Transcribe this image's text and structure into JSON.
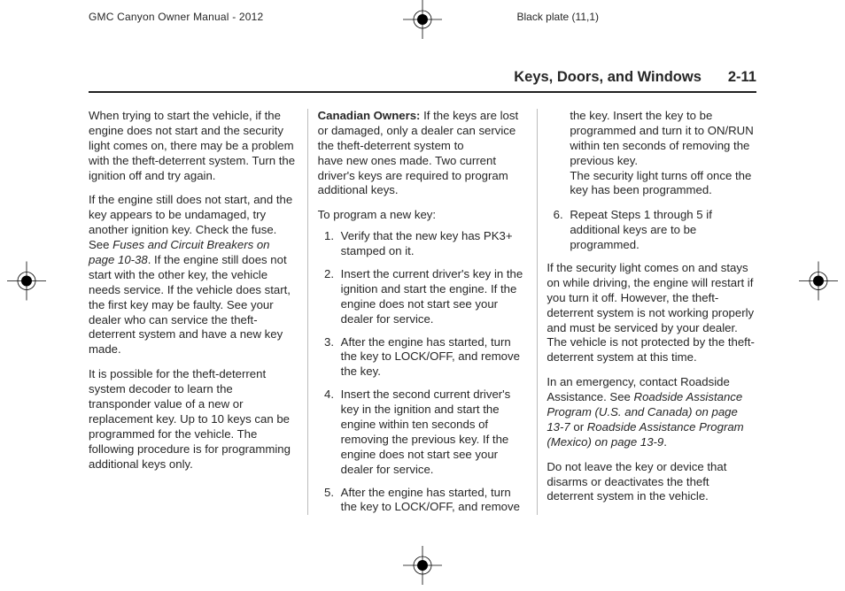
{
  "header": {
    "publication": "GMC Canyon Owner Manual - 2012",
    "plate": "Black plate (11,1)"
  },
  "running_head": {
    "section_title": "Keys, Doors, and Windows",
    "page_number": "2-11"
  },
  "body": {
    "p1": "When trying to start the vehicle, if the engine does not start and the security light comes on, there may be a problem with the theft-deterrent system. Turn the ignition off and try again.",
    "p2a": "If the engine still does not start, and the key appears to be undamaged, try another ignition key. Check the fuse. See ",
    "p2_italic": "Fuses and Circuit Breakers on page 10-38",
    "p2b": ". If the engine still does not start with the other key, the vehicle needs service. If the vehicle does start, the first key may be faulty. See your dealer who can service the theft-deterrent system and have a new key made.",
    "p3": "It is possible for the theft-deterrent system decoder to learn the transponder value of a new or replacement key. Up to 10 keys can be programmed for the vehicle. The following procedure is for programming additional keys only.",
    "p4_label": "Canadian Owners:",
    "p4_rest": "   If the keys are lost or damaged, only a dealer can service the theft-deterrent system to",
    "p5": "have new ones made. Two current driver's keys are required to program additional keys.",
    "p6": "To program a new key:",
    "steps": [
      "Verify that the new key has PK3+ stamped on it.",
      "Insert the current driver's key in the ignition and start the engine. If the engine does not start see your dealer for service.",
      "After the engine has started, turn the key to LOCK/OFF, and remove the key.",
      "Insert the second current driver's key in the ignition and start the engine within ten seconds of removing the previous key. If the engine does not start see your dealer for service.",
      "After the engine has started, turn the key to LOCK/OFF, and remove the key. Insert the key to be programmed and turn it to ON/RUN within ten seconds of removing the previous key."
    ],
    "step5_trail": "The security light turns off once the key has been programmed.",
    "step6": "Repeat Steps 1 through 5 if additional keys are to be programmed.",
    "p7": "If the security light comes on and stays on while driving, the engine will restart if you turn it off. However, the theft-deterrent system is not working properly and must be serviced by your dealer. The vehicle is not protected by the theft-deterrent system at this time.",
    "p8a": "In an emergency, contact Roadside Assistance. See ",
    "p8_italic": "Roadside Assistance Program (U.S. and Canada) on page 13-7",
    "p8b": " or ",
    "p8_italic2": "Roadside Assistance Program (Mexico) on page 13-9",
    "p8c": ".",
    "p9": "Do not leave the key or device that disarms or deactivates the theft deterrent system in the vehicle."
  }
}
